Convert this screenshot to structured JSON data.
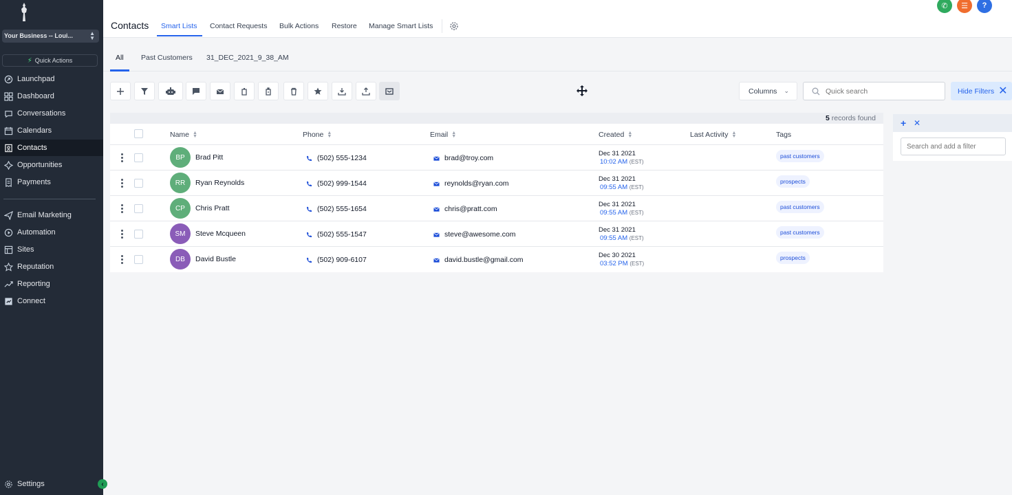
{
  "sidebar": {
    "business": "Your Business -- Loui...",
    "quick_actions": "Quick Actions",
    "items": [
      {
        "label": "Launchpad",
        "icon": "rocket-icon"
      },
      {
        "label": "Dashboard",
        "icon": "grid-icon"
      },
      {
        "label": "Conversations",
        "icon": "chat-icon"
      },
      {
        "label": "Calendars",
        "icon": "calendar-icon"
      },
      {
        "label": "Contacts",
        "icon": "contacts-icon",
        "active": true
      },
      {
        "label": "Opportunities",
        "icon": "funnel-icon"
      },
      {
        "label": "Payments",
        "icon": "receipt-icon"
      },
      {
        "label": "Email Marketing",
        "icon": "send-icon"
      },
      {
        "label": "Automation",
        "icon": "automation-icon"
      },
      {
        "label": "Sites",
        "icon": "sites-icon"
      },
      {
        "label": "Reputation",
        "icon": "star-icon"
      },
      {
        "label": "Reporting",
        "icon": "trend-icon"
      },
      {
        "label": "Connect",
        "icon": "connect-icon"
      }
    ],
    "settings": "Settings"
  },
  "header": {
    "title": "Contacts",
    "tabs": [
      "Smart Lists",
      "Contact Requests",
      "Bulk Actions",
      "Restore",
      "Manage Smart Lists"
    ],
    "active_tab": "Smart Lists",
    "colors": {
      "phone_btn": "#2faa5e",
      "list_btn": "#f06d2e",
      "help_btn": "#2f6fe3",
      "accent": "#2563eb"
    }
  },
  "subtabs": [
    "All",
    "Past Customers",
    "31_DEC_2021_9_38_AM"
  ],
  "toolbar": {
    "columns_label": "Columns",
    "search_placeholder": "Quick search",
    "hide_filters_label": "Hide Filters"
  },
  "records": {
    "count": "5",
    "label": "records found"
  },
  "table": {
    "headers": {
      "name": "Name",
      "phone": "Phone",
      "email": "Email",
      "created": "Created",
      "last_activity": "Last Activity",
      "tags": "Tags"
    },
    "rows": [
      {
        "initials": "BP",
        "name": "Brad Pitt",
        "phone": "(502) 555-1234",
        "email": "brad@troy.com",
        "date": "Dec 31 2021",
        "time": "10:02 AM",
        "tz": "(EST)",
        "tag": "past customers"
      },
      {
        "initials": "RR",
        "name": "Ryan Reynolds",
        "phone": "(502) 999-1544",
        "email": "reynolds@ryan.com",
        "date": "Dec 31 2021",
        "time": "09:55 AM",
        "tz": "(EST)",
        "tag": "prospects"
      },
      {
        "initials": "CP",
        "name": "Chris Pratt",
        "phone": "(502) 555-1654",
        "email": "chris@pratt.com",
        "date": "Dec 31 2021",
        "time": "09:55 AM",
        "tz": "(EST)",
        "tag": "past customers"
      },
      {
        "initials": "SM",
        "name": "Steve Mcqueen",
        "phone": "(502) 555-1547",
        "email": "steve@awesome.com",
        "date": "Dec 31 2021",
        "time": "09:55 AM",
        "tz": "(EST)",
        "tag": "past customers"
      },
      {
        "initials": "DB",
        "name": "David Bustle",
        "phone": "(502) 909-6107",
        "email": "david.bustle@gmail.com",
        "date": "Dec 30 2021",
        "time": "03:52 PM",
        "tz": "(EST)",
        "tag": "prospects"
      }
    ],
    "avatar_colors": [
      "#5fae7a",
      "#5fae7a",
      "#5fae7a",
      "#8a5cb8",
      "#8a5cb8"
    ]
  },
  "filter_panel": {
    "placeholder": "Search and add a filter"
  }
}
